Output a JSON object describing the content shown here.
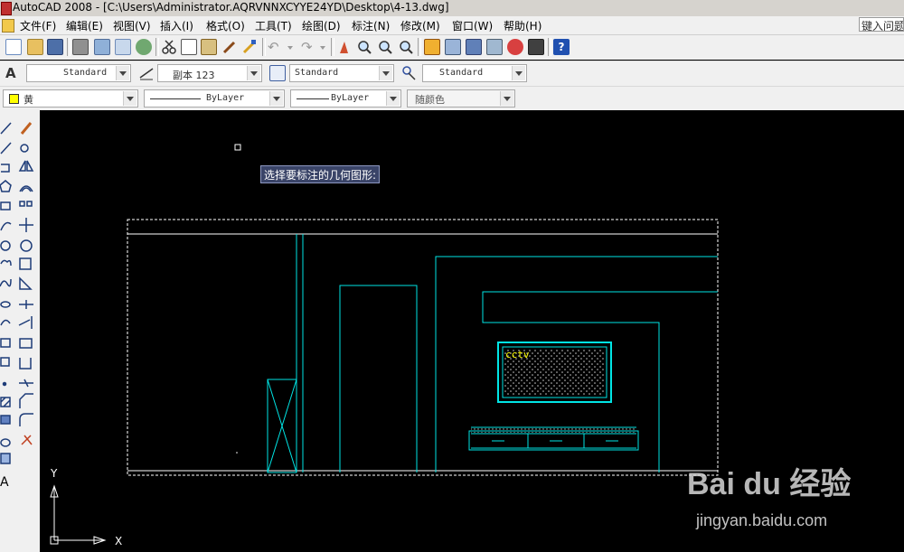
{
  "window": {
    "title": "AutoCAD 2008 - [C:\\Users\\Administrator.AQRVNNXCYYE24YD\\Desktop\\4-13.dwg]"
  },
  "menu": {
    "items": [
      "文件(F)",
      "编辑(E)",
      "视图(V)",
      "插入(I)",
      "格式(O)",
      "工具(T)",
      "绘图(D)",
      "标注(N)",
      "修改(M)",
      "窗口(W)",
      "帮助(H)"
    ],
    "help_input": "键入问题"
  },
  "styles_toolbar": {
    "text_style": "Standard",
    "dim_style": "副本 123",
    "table_style": "Standard",
    "mleader_style": "Standard"
  },
  "layers_toolbar": {
    "color": "黄",
    "linetype": "ByLayer",
    "lineweight": "ByLayer",
    "plot_style": "随颜色"
  },
  "canvas": {
    "tooltip": "选择要标注的几何图形:",
    "tv_label": "cctv",
    "ucs_x": "X",
    "ucs_y": "Y"
  },
  "colors": {
    "cyan": "#00e5e5",
    "white": "#ffffff",
    "yellow_swatch": "#ffff00"
  },
  "watermark": {
    "logo": "Bai du 经验",
    "url": "jingyan.baidu.com"
  }
}
